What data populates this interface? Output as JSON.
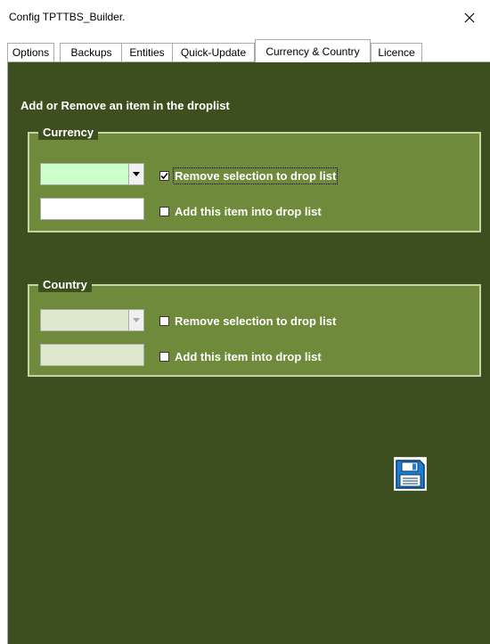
{
  "window": {
    "title": "Config TPTTBS_Builder.",
    "close_glyph": "✕"
  },
  "tabs": [
    {
      "label": "Options"
    },
    {
      "label": "Backups"
    },
    {
      "label": "Entities"
    },
    {
      "label": "Quick-Update"
    },
    {
      "label": "Currency & Country",
      "active": true
    },
    {
      "label": "Licence"
    }
  ],
  "panel": {
    "heading": "Add or Remove an item in the droplist",
    "currency": {
      "title": "Currency",
      "combo_value": "",
      "add_value": "",
      "remove_label": "Remove selection to drop list",
      "remove_checked": true,
      "add_label": "Add this item into drop list",
      "add_checked": false
    },
    "country": {
      "title": "Country",
      "combo_value": "",
      "add_value": "",
      "remove_label": "Remove selection to drop list",
      "remove_checked": false,
      "add_label": "Add this item into drop list",
      "add_checked": false
    },
    "save_icon": "floppy-disk-icon"
  },
  "colors": {
    "panel_bg": "#3e4f1f",
    "frame_bg": "#6e8a3a",
    "currency_combo_bg": "#ccffcc",
    "country_field_bg": "#dde8cc",
    "save_icon": "#1a7fd4"
  }
}
